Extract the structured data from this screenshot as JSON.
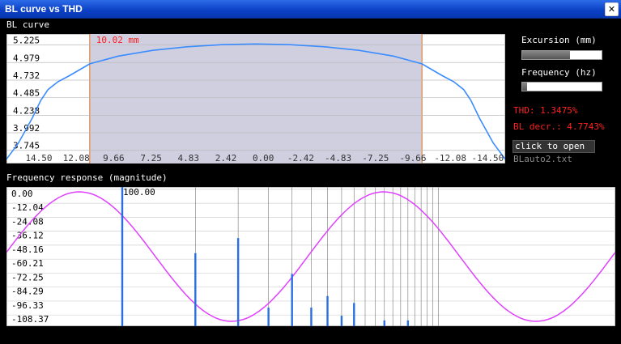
{
  "window": {
    "title": "BL curve vs THD",
    "close_glyph": "✕"
  },
  "bl_section": {
    "label": "BL curve"
  },
  "fr_section": {
    "label": "Frequency response (magnitude)"
  },
  "controls": {
    "excursion_label": "Excursion (mm)",
    "excursion_fraction": 0.6,
    "frequency_label": "Frequency (hz)",
    "frequency_fraction": 0.06,
    "thd_text": "THD: 1.3475%",
    "bl_decr_text": "BL decr.: 4.7743%",
    "open_button_label": "click to open",
    "file_name": "BLauto2.txt"
  },
  "colors": {
    "accent_red": "#ff2020",
    "bl_curve": "#3a8cff",
    "shade": "#cfcfe0",
    "sine": "#e040ff",
    "spikes": "#2a6fe0"
  },
  "chart_data": [
    {
      "type": "line",
      "title": "BL curve",
      "x_tick_labels": [
        "14.50",
        "12.08",
        "9.66",
        "7.25",
        "4.83",
        "2.42",
        "0.00",
        "-2.42",
        "-4.83",
        "-7.25",
        "-9.66",
        "-12.08",
        "-14.50"
      ],
      "y_tick_labels": [
        "5.225",
        "4.979",
        "4.732",
        "4.485",
        "4.238",
        "3.992",
        "3.745"
      ],
      "xlim": [
        14.5,
        -14.5
      ],
      "ylim": [
        3.56,
        5.38
      ],
      "shaded_range_label": "10.02 mm",
      "shaded_range": [
        9.66,
        -9.66
      ],
      "series": [
        {
          "values": [
            [
              14.5,
              3.62
            ],
            [
              13.8,
              3.85
            ],
            [
              13.0,
              4.2
            ],
            [
              12.5,
              4.45
            ],
            [
              12.08,
              4.6
            ],
            [
              11.5,
              4.71
            ],
            [
              10.8,
              4.8
            ],
            [
              9.66,
              4.96
            ],
            [
              8.0,
              5.07
            ],
            [
              6.0,
              5.15
            ],
            [
              4.0,
              5.2
            ],
            [
              2.0,
              5.23
            ],
            [
              0.0,
              5.24
            ],
            [
              -2.0,
              5.23
            ],
            [
              -4.0,
              5.2
            ],
            [
              -6.0,
              5.15
            ],
            [
              -8.0,
              5.07
            ],
            [
              -9.66,
              4.96
            ],
            [
              -10.8,
              4.8
            ],
            [
              -11.5,
              4.71
            ],
            [
              -12.08,
              4.6
            ],
            [
              -12.5,
              4.45
            ],
            [
              -13.0,
              4.2
            ],
            [
              -13.8,
              3.85
            ],
            [
              -14.5,
              3.62
            ]
          ]
        }
      ]
    },
    {
      "type": "line",
      "title": "Frequency response (magnitude)",
      "y_tick_labels": [
        "0.00",
        "-12.04",
        "-24.08",
        "-36.12",
        "-48.16",
        "-60.21",
        "-72.25",
        "-84.29",
        "-96.33",
        "-108.37"
      ],
      "ylim": [
        -118,
        2
      ],
      "marker_label": "100.00",
      "sine_cycles": 2.0,
      "spikes": [
        {
          "harmonic": 1,
          "db": 2.0
        },
        {
          "harmonic": 2,
          "db": -55
        },
        {
          "harmonic": 3,
          "db": -42
        },
        {
          "harmonic": 4,
          "db": -102
        },
        {
          "harmonic": 5,
          "db": -73
        },
        {
          "harmonic": 6,
          "db": -102
        },
        {
          "harmonic": 7,
          "db": -92
        },
        {
          "harmonic": 8,
          "db": -109
        },
        {
          "harmonic": 9,
          "db": -98
        },
        {
          "harmonic": 10,
          "db": -128
        },
        {
          "harmonic": 11,
          "db": -130
        },
        {
          "harmonic": 12,
          "db": -113
        },
        {
          "harmonic": 13,
          "db": -129
        },
        {
          "harmonic": 15,
          "db": -113
        },
        {
          "harmonic": 16,
          "db": -126
        },
        {
          "harmonic": 20,
          "db": -122
        },
        {
          "harmonic": 22,
          "db": -132
        },
        {
          "harmonic": 25,
          "db": -127
        }
      ]
    }
  ]
}
